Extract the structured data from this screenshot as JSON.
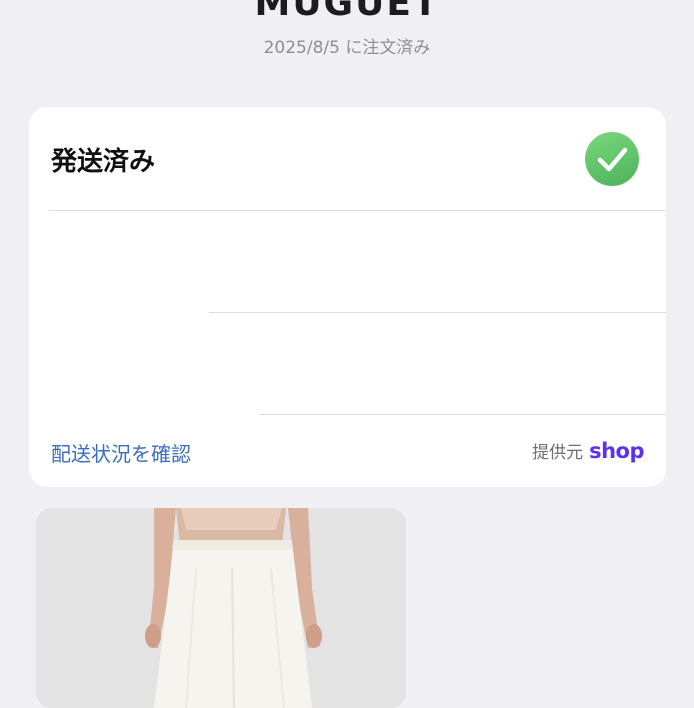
{
  "header": {
    "store_name": "MUGUET",
    "order_date": "2025/8/5 に注文済み"
  },
  "shipment": {
    "status": "発送済み",
    "track_link": "配送状況を確認",
    "provided_by": "提供元",
    "provider_name": "shop"
  },
  "icons": {
    "status": "checkmark-circle-icon"
  },
  "colors": {
    "background": "#efeff4",
    "card": "#ffffff",
    "success_green": "#5cc46a",
    "link_blue": "#3a6fc0",
    "shop_purple": "#5a31f4"
  },
  "product": {
    "image": "white-wide-pants-photo"
  }
}
